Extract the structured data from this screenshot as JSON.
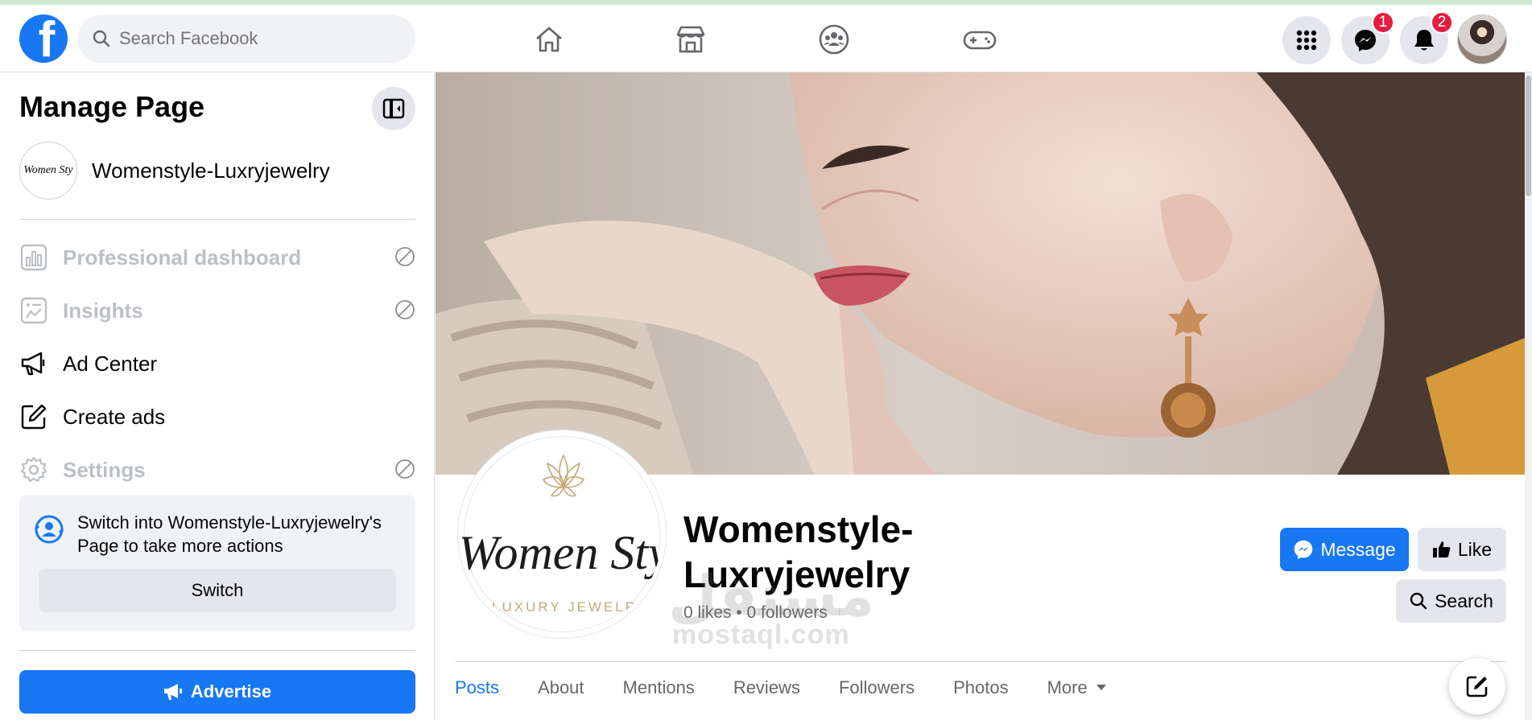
{
  "topbar": {
    "logo": "f",
    "search_placeholder": "Search Facebook",
    "nav_icons": [
      "home-icon",
      "marketplace-icon",
      "groups-icon",
      "gaming-icon"
    ],
    "right_icons": [
      "menu-grid-icon",
      "messenger-icon",
      "notifications-icon"
    ],
    "messenger_badge": "1",
    "notifications_badge": "2"
  },
  "sidebar": {
    "title": "Manage Page",
    "page_name": "Womenstyle-Luxryjewelry",
    "page_avatar_text": "Women Sty",
    "items": [
      {
        "label": "Professional dashboard",
        "icon": "dashboard-icon",
        "disabled": true
      },
      {
        "label": "Insights",
        "icon": "insights-icon",
        "disabled": true
      },
      {
        "label": "Ad Center",
        "icon": "megaphone-icon",
        "disabled": false
      },
      {
        "label": "Create ads",
        "icon": "edit-icon",
        "disabled": false
      },
      {
        "label": "Settings",
        "icon": "gear-icon",
        "disabled": true
      }
    ],
    "switch_text": "Switch into Womenstyle-Luxryjewelry's Page to take more actions",
    "switch_button": "Switch",
    "advertise_button": "Advertise"
  },
  "profile": {
    "logo_script": "Women Sty",
    "logo_sub": "LUXURY JEWELR",
    "name": "Womenstyle-Luxryjewelry",
    "stats": "0 likes • 0 followers",
    "message_button": "Message",
    "like_button": "Like",
    "search_button": "Search"
  },
  "tabs": [
    {
      "label": "Posts",
      "active": true
    },
    {
      "label": "About",
      "active": false
    },
    {
      "label": "Mentions",
      "active": false
    },
    {
      "label": "Reviews",
      "active": false
    },
    {
      "label": "Followers",
      "active": false
    },
    {
      "label": "Photos",
      "active": false
    },
    {
      "label": "More",
      "active": false
    }
  ],
  "watermark": {
    "latin": "mostaql.com",
    "arabic": "مستقل"
  },
  "colors": {
    "accent": "#1877f2",
    "badge": "#e41e3f",
    "background": "#f0f2f5"
  }
}
